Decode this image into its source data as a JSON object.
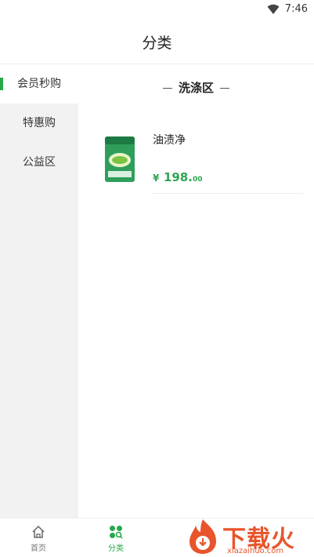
{
  "status_bar": {
    "time": "7:46"
  },
  "header": {
    "title": "分类"
  },
  "sidebar": {
    "items": [
      {
        "label": "会员秒购",
        "active": true
      },
      {
        "label": "特惠购",
        "active": false
      },
      {
        "label": "公益区",
        "active": false
      }
    ]
  },
  "main": {
    "section_title": "洗涤区",
    "products": [
      {
        "name": "油渍净",
        "currency": "¥",
        "price_int": "198.",
        "price_dec": "00"
      }
    ]
  },
  "tab_bar": {
    "tabs": [
      {
        "label": "首页",
        "icon": "home-icon",
        "active": false
      },
      {
        "label": "分类",
        "icon": "category-icon",
        "active": true
      }
    ]
  },
  "watermark": {
    "text": "下载火",
    "url": "xiazaihuo.com"
  },
  "colors": {
    "accent": "#27a84a",
    "price": "#2fa551",
    "sidebar_bg": "#f2f2f2",
    "watermark": "#e8542b"
  }
}
